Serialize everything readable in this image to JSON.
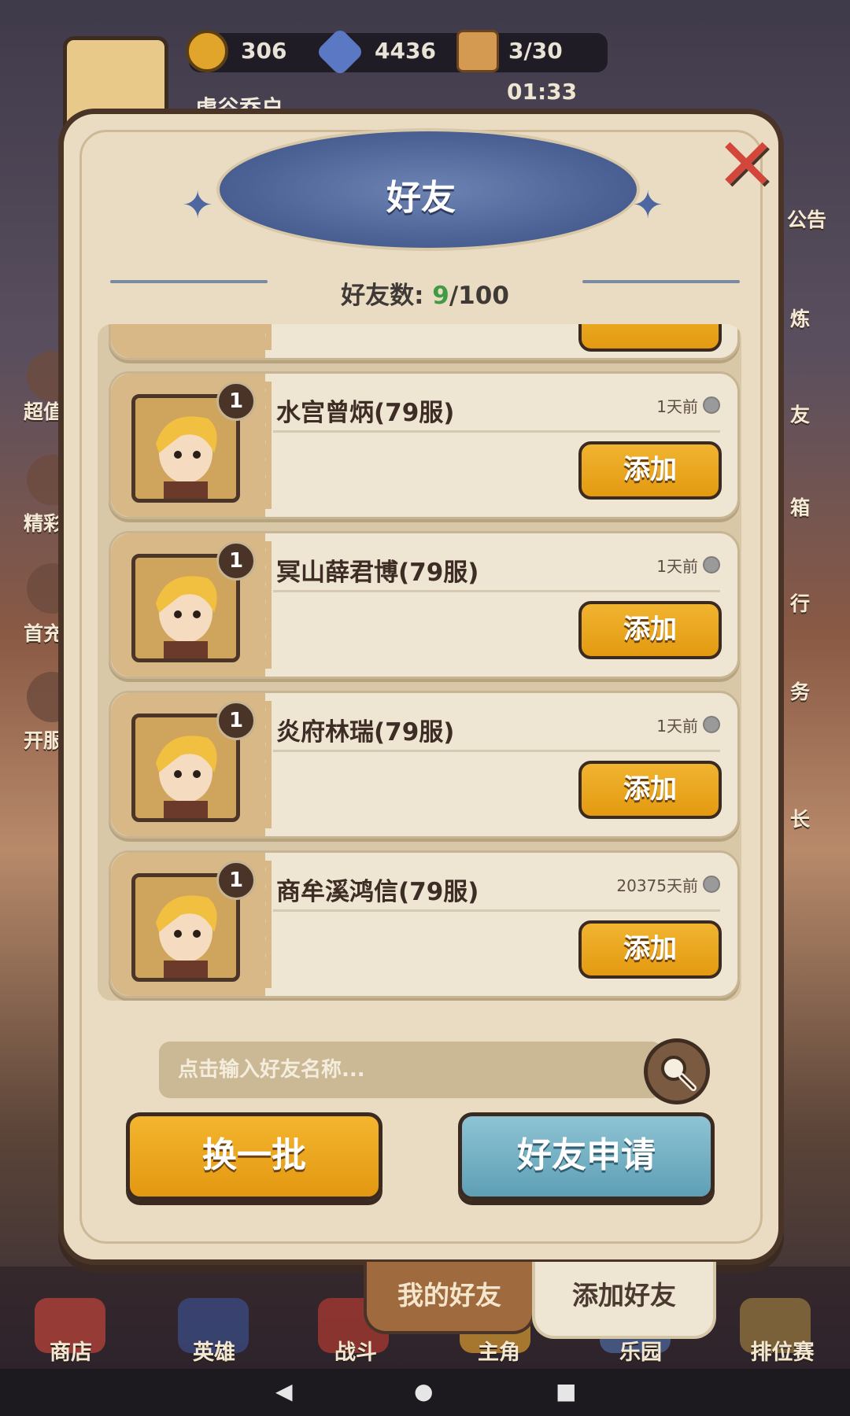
{
  "hud": {
    "player_name": "虎谷乔户",
    "resources": [
      {
        "icon": "coin-icon",
        "value": "306"
      },
      {
        "icon": "star-gem-icon",
        "value": "4436"
      },
      {
        "icon": "biscuit-stamina-icon",
        "value": "3/30"
      }
    ],
    "timer": "01:33",
    "side_left": [
      "超值",
      "精彩",
      "首充",
      "开服"
    ],
    "side_right": [
      "公告",
      "炼",
      "友",
      "箱",
      "行",
      "务",
      "长"
    ]
  },
  "modal": {
    "title": "好友",
    "count_label": "好友数:",
    "count_current": "9",
    "count_max": "/100"
  },
  "friends": [
    {
      "level": "1",
      "name": "水宫曾炳(79服)",
      "last_seen": "1天前",
      "button": "添加"
    },
    {
      "level": "1",
      "name": "冥山薛君博(79服)",
      "last_seen": "1天前",
      "button": "添加"
    },
    {
      "level": "1",
      "name": "炎府林瑞(79服)",
      "last_seen": "1天前",
      "button": "添加"
    },
    {
      "level": "1",
      "name": "商牟溪鸿信(79服)",
      "last_seen": "20375天前",
      "button": "添加"
    }
  ],
  "search": {
    "placeholder": "点击输入好友名称..."
  },
  "actions": {
    "refresh": "换一批",
    "friend_requests": "好友申请"
  },
  "tabs": {
    "my_friends": "我的好友",
    "add_friends": "添加好友"
  },
  "bottom_nav": [
    "商店",
    "英雄",
    "战斗",
    "主角",
    "乐园",
    "排位赛"
  ]
}
